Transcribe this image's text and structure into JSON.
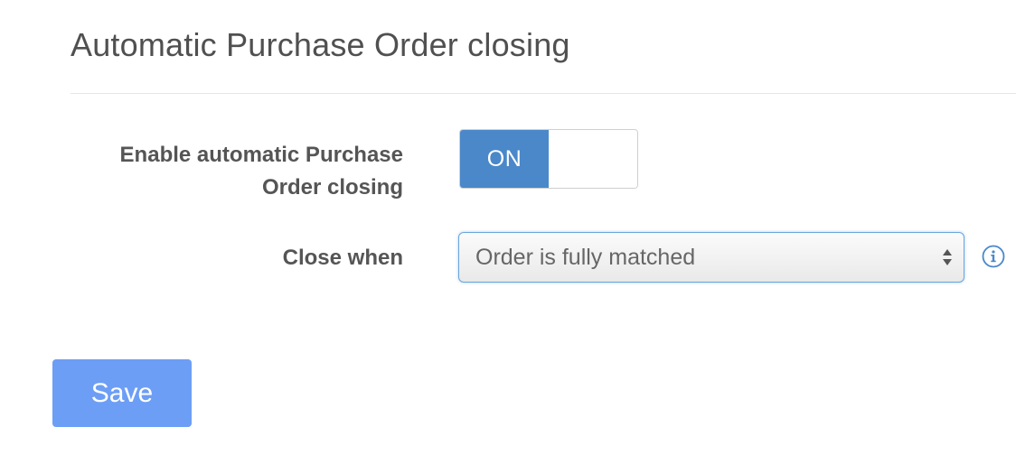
{
  "page": {
    "title": "Automatic Purchase Order closing"
  },
  "form": {
    "enable_auto_close": {
      "label": "Enable automatic Purchase Order closing",
      "toggle_state_label": "ON",
      "enabled": true
    },
    "close_when": {
      "label": "Close when",
      "selected_value": "Order is fully matched",
      "info_icon": "info-circle-icon",
      "arrows_icon": "up-down-arrows-icon"
    }
  },
  "actions": {
    "save_label": "Save"
  },
  "colors": {
    "toggle_on": "#4a88c9",
    "save_button": "#6d9ef5",
    "info_icon": "#4a88c9",
    "select_focus_border": "#6aa5dc"
  }
}
